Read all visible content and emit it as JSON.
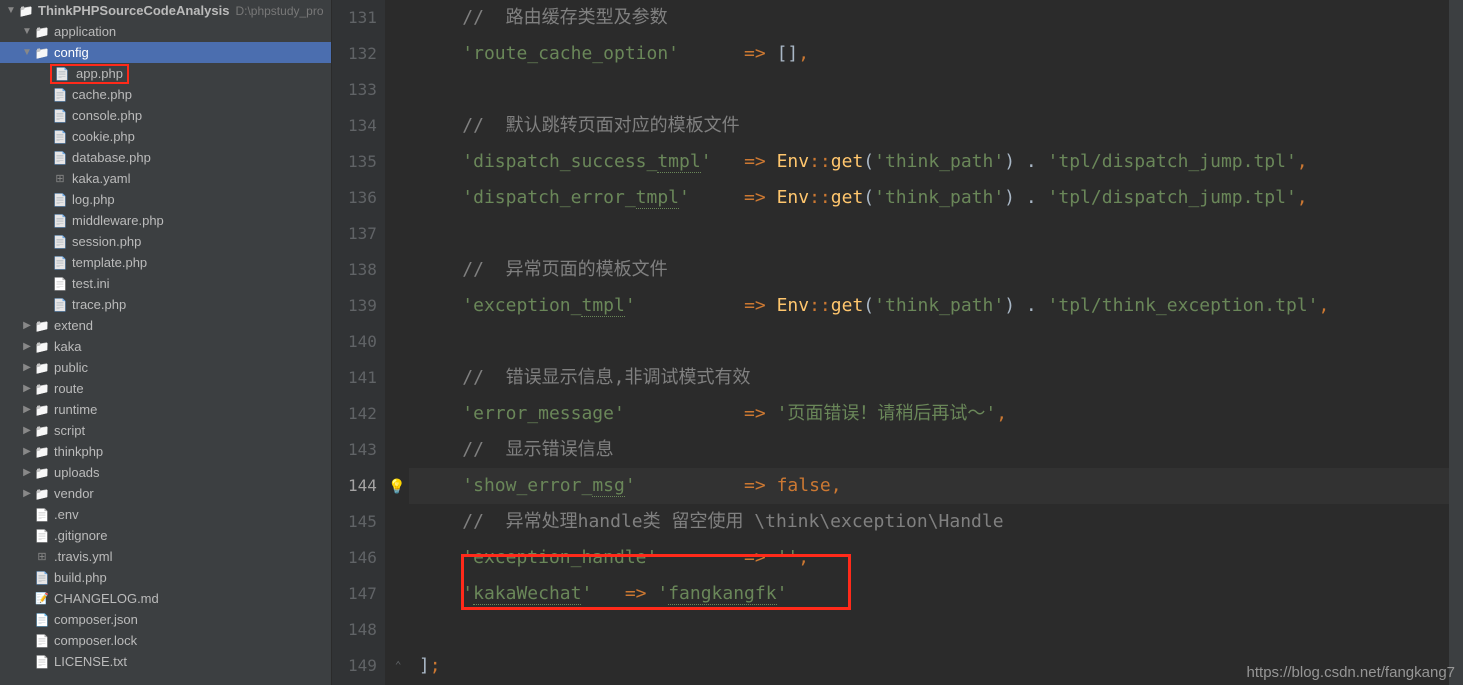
{
  "project": {
    "name": "ThinkPHPSourceCodeAnalysis",
    "path": "D:\\phpstudy_pro"
  },
  "tree": [
    {
      "indent": 0,
      "arrow": "open",
      "icon": "folder",
      "label": "application",
      "bold": false
    },
    {
      "indent": 0,
      "arrow": "open",
      "icon": "folder",
      "label": "config",
      "bold": false,
      "selected": true
    },
    {
      "indent": 1,
      "arrow": "none",
      "icon": "php",
      "label": "app.php",
      "highlight": true
    },
    {
      "indent": 1,
      "arrow": "none",
      "icon": "php",
      "label": "cache.php"
    },
    {
      "indent": 1,
      "arrow": "none",
      "icon": "php",
      "label": "console.php"
    },
    {
      "indent": 1,
      "arrow": "none",
      "icon": "php",
      "label": "cookie.php"
    },
    {
      "indent": 1,
      "arrow": "none",
      "icon": "php",
      "label": "database.php"
    },
    {
      "indent": 1,
      "arrow": "none",
      "icon": "yaml",
      "label": "kaka.yaml"
    },
    {
      "indent": 1,
      "arrow": "none",
      "icon": "php",
      "label": "log.php"
    },
    {
      "indent": 1,
      "arrow": "none",
      "icon": "php",
      "label": "middleware.php"
    },
    {
      "indent": 1,
      "arrow": "none",
      "icon": "php",
      "label": "session.php"
    },
    {
      "indent": 1,
      "arrow": "none",
      "icon": "php",
      "label": "template.php"
    },
    {
      "indent": 1,
      "arrow": "none",
      "icon": "txt",
      "label": "test.ini"
    },
    {
      "indent": 1,
      "arrow": "none",
      "icon": "php",
      "label": "trace.php"
    },
    {
      "indent": 0,
      "arrow": "closed",
      "icon": "folder",
      "label": "extend"
    },
    {
      "indent": 0,
      "arrow": "closed",
      "icon": "folder",
      "label": "kaka"
    },
    {
      "indent": 0,
      "arrow": "closed",
      "icon": "folder",
      "label": "public"
    },
    {
      "indent": 0,
      "arrow": "closed",
      "icon": "folder",
      "label": "route"
    },
    {
      "indent": 0,
      "arrow": "closed",
      "icon": "folder",
      "label": "runtime"
    },
    {
      "indent": 0,
      "arrow": "closed",
      "icon": "folder",
      "label": "script"
    },
    {
      "indent": 0,
      "arrow": "closed",
      "icon": "folder",
      "label": "thinkphp"
    },
    {
      "indent": 0,
      "arrow": "closed",
      "icon": "folder",
      "label": "uploads"
    },
    {
      "indent": 0,
      "arrow": "closed",
      "icon": "folder",
      "label": "vendor"
    },
    {
      "indent": 0,
      "arrow": "none",
      "icon": "txt",
      "label": ".env"
    },
    {
      "indent": 0,
      "arrow": "none",
      "icon": "txt",
      "label": ".gitignore"
    },
    {
      "indent": 0,
      "arrow": "none",
      "icon": "yaml",
      "label": ".travis.yml"
    },
    {
      "indent": 0,
      "arrow": "none",
      "icon": "php",
      "label": "build.php"
    },
    {
      "indent": 0,
      "arrow": "none",
      "icon": "md",
      "label": "CHANGELOG.md"
    },
    {
      "indent": 0,
      "arrow": "none",
      "icon": "json",
      "label": "composer.json"
    },
    {
      "indent": 0,
      "arrow": "none",
      "icon": "txt",
      "label": "composer.lock"
    },
    {
      "indent": 0,
      "arrow": "none",
      "icon": "txt",
      "label": "LICENSE.txt"
    }
  ],
  "editor": {
    "lines": [
      {
        "n": 131,
        "tokens": [
          [
            "    ",
            "def"
          ],
          [
            "//  路由缓存类型及参数",
            "cmt"
          ]
        ]
      },
      {
        "n": 132,
        "tokens": [
          [
            "    ",
            "def"
          ],
          [
            "'route_cache_option'",
            "str"
          ],
          [
            "      ",
            "def"
          ],
          [
            "=> ",
            "op"
          ],
          [
            "[]",
            "def"
          ],
          [
            ",",
            "op"
          ]
        ]
      },
      {
        "n": 133,
        "tokens": []
      },
      {
        "n": 134,
        "tokens": [
          [
            "    ",
            "def"
          ],
          [
            "//  默认跳转页面对应的模板文件",
            "cmt"
          ]
        ]
      },
      {
        "n": 135,
        "tokens": [
          [
            "    ",
            "def"
          ],
          [
            "'dispatch_success_",
            "str"
          ],
          [
            "tmpl",
            "str squig"
          ],
          [
            "'",
            "str"
          ],
          [
            "   ",
            "def"
          ],
          [
            "=> ",
            "op"
          ],
          [
            "Env",
            "cls ul"
          ],
          [
            "::",
            "op"
          ],
          [
            "get",
            "fn"
          ],
          [
            "(",
            "def"
          ],
          [
            "'think_path'",
            "str"
          ],
          [
            ") . ",
            "def"
          ],
          [
            "'tpl/dispatch_jump.tpl'",
            "str"
          ],
          [
            ",",
            "op"
          ]
        ]
      },
      {
        "n": 136,
        "tokens": [
          [
            "    ",
            "def"
          ],
          [
            "'dispatch_error_",
            "str"
          ],
          [
            "tmpl",
            "str squig"
          ],
          [
            "'",
            "str"
          ],
          [
            "     ",
            "def"
          ],
          [
            "=> ",
            "op"
          ],
          [
            "Env",
            "cls ul"
          ],
          [
            "::",
            "op"
          ],
          [
            "get",
            "fn"
          ],
          [
            "(",
            "def"
          ],
          [
            "'think_path'",
            "str"
          ],
          [
            ") . ",
            "def"
          ],
          [
            "'tpl/dispatch_jump.tpl'",
            "str"
          ],
          [
            ",",
            "op"
          ]
        ]
      },
      {
        "n": 137,
        "tokens": []
      },
      {
        "n": 138,
        "tokens": [
          [
            "    ",
            "def"
          ],
          [
            "//  异常页面的模板文件",
            "cmt"
          ]
        ]
      },
      {
        "n": 139,
        "tokens": [
          [
            "    ",
            "def"
          ],
          [
            "'exception_",
            "str"
          ],
          [
            "tmpl",
            "str squig"
          ],
          [
            "'",
            "str"
          ],
          [
            "          ",
            "def"
          ],
          [
            "=> ",
            "op"
          ],
          [
            "Env",
            "cls ul"
          ],
          [
            "::",
            "op"
          ],
          [
            "get",
            "fn"
          ],
          [
            "(",
            "def"
          ],
          [
            "'think_path'",
            "str"
          ],
          [
            ") . ",
            "def"
          ],
          [
            "'tpl/think_exception.tpl'",
            "str"
          ],
          [
            ",",
            "op"
          ]
        ]
      },
      {
        "n": 140,
        "tokens": []
      },
      {
        "n": 141,
        "tokens": [
          [
            "    ",
            "def"
          ],
          [
            "//  错误显示信息,非调试模式有效",
            "cmt"
          ]
        ]
      },
      {
        "n": 142,
        "tokens": [
          [
            "    ",
            "def"
          ],
          [
            "'error_message'",
            "str"
          ],
          [
            "           ",
            "def"
          ],
          [
            "=> ",
            "op"
          ],
          [
            "'页面错误！请稍后再试～'",
            "str"
          ],
          [
            ",",
            "op"
          ]
        ]
      },
      {
        "n": 143,
        "tokens": [
          [
            "    ",
            "def"
          ],
          [
            "//  显示错误信息",
            "cmt"
          ]
        ]
      },
      {
        "n": 144,
        "tokens": [
          [
            "    ",
            "def"
          ],
          [
            "'show_error_",
            "str"
          ],
          [
            "msg",
            "str squig"
          ],
          [
            "'",
            "str"
          ],
          [
            "          ",
            "def"
          ],
          [
            "=> ",
            "op"
          ],
          [
            "false",
            "bool"
          ],
          [
            ",",
            "op"
          ]
        ],
        "hl": true,
        "bulb": true
      },
      {
        "n": 145,
        "tokens": [
          [
            "    ",
            "def"
          ],
          [
            "//  异常处理handle类 留空使用 \\think\\exception\\Handle",
            "cmt"
          ]
        ]
      },
      {
        "n": 146,
        "tokens": [
          [
            "    ",
            "def"
          ],
          [
            "'exception_handle'",
            "str"
          ],
          [
            "        ",
            "def"
          ],
          [
            "=> ",
            "op"
          ],
          [
            "''",
            "str"
          ],
          [
            ",",
            "op"
          ]
        ]
      },
      {
        "n": 147,
        "tokens": [
          [
            "    ",
            "def"
          ],
          [
            "'",
            "str"
          ],
          [
            "kakaWechat",
            "str squig"
          ],
          [
            "'",
            "str"
          ],
          [
            "   ",
            "def"
          ],
          [
            "=> ",
            "op"
          ],
          [
            "'",
            "str"
          ],
          [
            "fangkangfk",
            "str squig"
          ],
          [
            "'",
            "str"
          ]
        ],
        "redbox": true
      },
      {
        "n": 148,
        "tokens": []
      },
      {
        "n": 149,
        "tokens": [
          [
            "]",
            "def"
          ],
          [
            ";",
            "op"
          ]
        ],
        "close": true
      }
    ]
  },
  "watermark": "https://blog.csdn.net/fangkang7"
}
